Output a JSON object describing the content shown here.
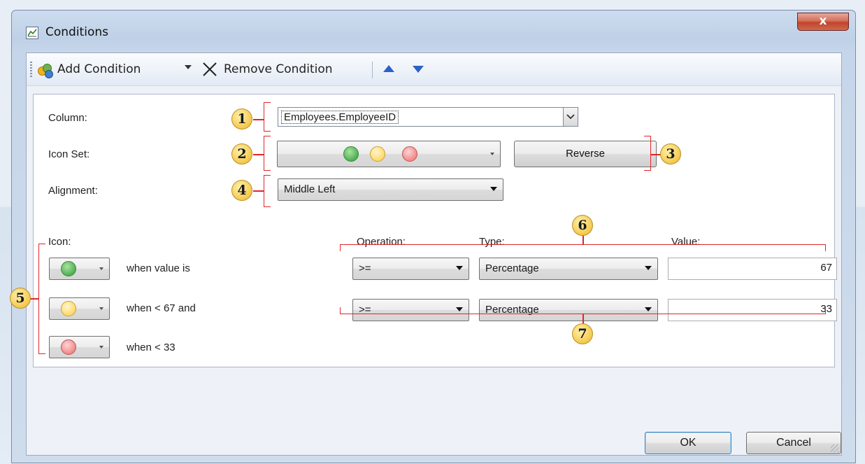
{
  "window": {
    "title": "Conditions",
    "close_label": "x"
  },
  "toolbar": {
    "add_label": "Add Condition",
    "remove_label": "Remove Condition"
  },
  "form": {
    "column_label": "Column:",
    "column_value": "Employees.EmployeeID",
    "iconset_label": "Icon Set:",
    "iconset_colors": [
      "green",
      "yellow",
      "red"
    ],
    "reverse_label": "Reverse",
    "alignment_label": "Alignment:",
    "alignment_value": "Middle Left"
  },
  "headers": {
    "icon": "Icon:",
    "operation": "Operation:",
    "type": "Type:",
    "value": "Value:"
  },
  "rows": [
    {
      "icon_color": "green",
      "text": "when value is",
      "operation": ">=",
      "type": "Percentage",
      "value": "67"
    },
    {
      "icon_color": "yellow",
      "text": "when < 67 and",
      "operation": ">=",
      "type": "Percentage",
      "value": "33"
    },
    {
      "icon_color": "red",
      "text": "when < 33"
    }
  ],
  "callouts": [
    "1",
    "2",
    "3",
    "4",
    "5",
    "6",
    "7"
  ],
  "footer": {
    "ok_label": "OK",
    "cancel_label": "Cancel"
  },
  "colors": {
    "accent_red": "#e0262a",
    "icon_green": "#4fb053",
    "icon_yellow": "#ffd96a",
    "icon_red": "#f08a8a"
  }
}
